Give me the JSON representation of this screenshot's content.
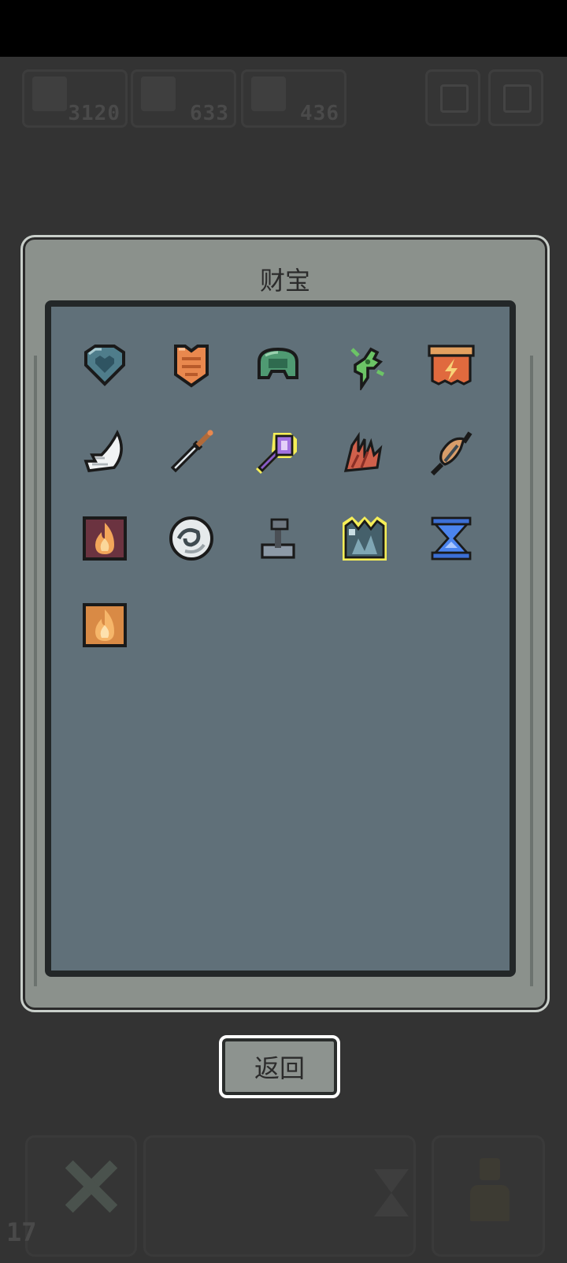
{
  "hud": {
    "resources": [
      {
        "icon": "wand-icon",
        "value": "3120"
      },
      {
        "icon": "chest-icon",
        "value": "633"
      },
      {
        "icon": "gem-pile-icon",
        "value": "436"
      }
    ]
  },
  "dialog": {
    "title": "财宝",
    "items": [
      {
        "name": "blue-heart-gem-icon"
      },
      {
        "name": "orange-shield-icon"
      },
      {
        "name": "green-helmet-icon"
      },
      {
        "name": "green-branch-icon"
      },
      {
        "name": "lightning-banner-icon"
      },
      {
        "name": "white-wing-icon"
      },
      {
        "name": "steel-dagger-icon"
      },
      {
        "name": "purple-scepter-icon",
        "highlighted": true
      },
      {
        "name": "red-antler-icon"
      },
      {
        "name": "feather-spear-icon"
      },
      {
        "name": "flame-scroll-dark-icon"
      },
      {
        "name": "swirl-orb-icon"
      },
      {
        "name": "joystick-icon"
      },
      {
        "name": "crystal-crown-icon",
        "highlighted": true
      },
      {
        "name": "blue-hourglass-icon"
      },
      {
        "name": "flame-scroll-orange-icon"
      }
    ],
    "back_label": "返回"
  },
  "footer": {
    "level": "17"
  },
  "colors": {
    "background": "#333333",
    "dialog": "#8b918c",
    "panel": "#607079",
    "highlight": "#f5ee58"
  }
}
